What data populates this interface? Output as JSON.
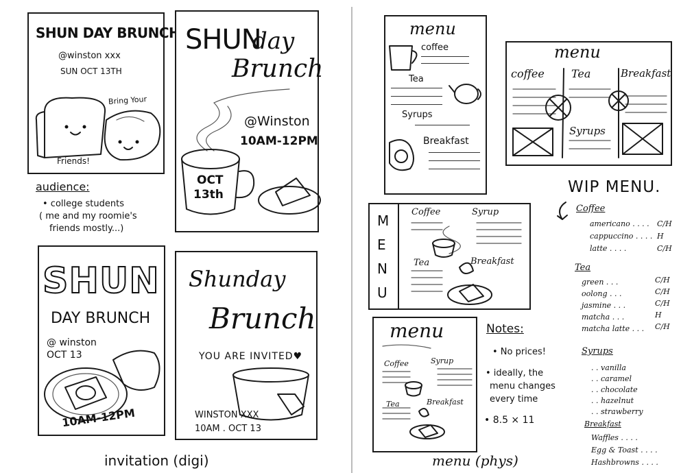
{
  "left": {
    "card1": {
      "title": "SHUN DAY BRUNCH!",
      "handle": "@winston xxx",
      "date": "SUN OCT 13TH",
      "bring": "Bring Your",
      "friends": "Friends!"
    },
    "card2": {
      "title1": "SHUN",
      "title2": "day",
      "title3": "Brunch",
      "location": "@Winston",
      "time": "10AM-12PM",
      "cup1": "OCT",
      "cup2": "13th"
    },
    "audience": {
      "label": "audience:",
      "line1": "• college students",
      "line2": "( me and my roomie's",
      "line3": "friends mostly...)"
    },
    "card3": {
      "title1": "SHUN",
      "title2": "DAY BRUNCH",
      "location": "@ winston",
      "date": "OCT 13",
      "time": "10AM-12PM"
    },
    "card4": {
      "title1": "Shunday",
      "title2": "Brunch",
      "invite": "YOU ARE INVITED♥",
      "where": "WINSTON XXX",
      "when": "10AM . OCT 13"
    },
    "caption": "invitation (digi)"
  },
  "right": {
    "menu1": {
      "title": "menu",
      "coffee": "coffee",
      "tea": "Tea",
      "syrups": "Syrups",
      "breakfast": "Breakfast"
    },
    "menu2": {
      "title": "menu",
      "coffee": "coffee",
      "tea": "Tea",
      "breakfast": "Breakfast",
      "syrups": "Syrups"
    },
    "menu3": {
      "side": [
        "M",
        "E",
        "N",
        "U"
      ],
      "coffee": "Coffee",
      "syrup": "Syrup",
      "tea": "Tea",
      "breakfast": "Breakfast"
    },
    "menu4": {
      "title": "menu",
      "coffee": "Coffee",
      "syrup": "Syrup",
      "tea": "Tea",
      "breakfast": "Breakfast"
    },
    "notes": {
      "title": "Notes:",
      "n1": "• No prices!",
      "n2a": "• ideally, the",
      "n2b": "menu changes",
      "n2c": "every time",
      "n3": "• 8.5 × 11"
    },
    "wip": {
      "title": "WIP MENU.",
      "coffee_h": "Coffee",
      "coffee": [
        {
          "name": "americano",
          "opt": "C/H"
        },
        {
          "name": "cappuccino",
          "opt": "H"
        },
        {
          "name": "latte",
          "opt": "C/H"
        }
      ],
      "tea_h": "Tea",
      "tea": [
        {
          "name": "green",
          "opt": "C/H"
        },
        {
          "name": "oolong",
          "opt": "C/H"
        },
        {
          "name": "jasmine",
          "opt": "C/H"
        },
        {
          "name": "matcha",
          "opt": "H"
        },
        {
          "name": "matcha latte",
          "opt": "C/H"
        }
      ],
      "syrups_h": "Syrups",
      "syrups": [
        "vanilla",
        "caramel",
        "chocolate",
        "hazelnut",
        "strawberry"
      ],
      "breakfast_h": "Breakfast",
      "breakfast": [
        "Waffles",
        "Egg & Toast",
        "Hashbrowns"
      ]
    },
    "caption": "menu (phys)"
  }
}
